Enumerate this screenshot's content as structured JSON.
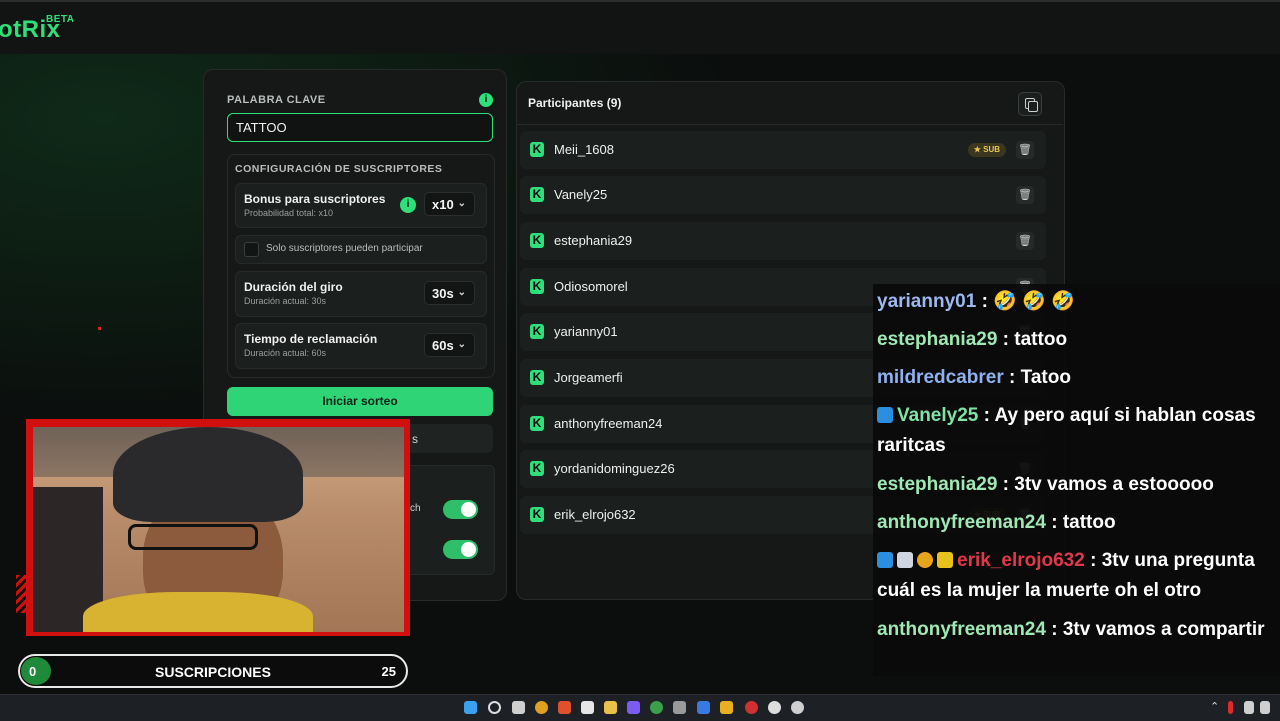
{
  "app": {
    "logo": "otRix",
    "badge": "BETA"
  },
  "keyword": {
    "label": "PALABRA CLAVE",
    "value": "TATTOO"
  },
  "subscriber_config": {
    "title": "CONFIGURACIÓN DE SUSCRIPTORES",
    "bonus": {
      "title": "Bonus para suscriptores",
      "subtitle": "Probabilidad total: x10",
      "value": "x10"
    },
    "subs_only": {
      "label": "Solo suscriptores pueden participar"
    },
    "spin_duration": {
      "title": "Duración del giro",
      "subtitle": "Duración actual: 30s",
      "value": "30s"
    },
    "claim_time": {
      "title": "Tiempo de reclamación",
      "subtitle": "Duración actual: 60s",
      "value": "60s"
    },
    "start_button": "Iniciar sorteo",
    "partial_button": "s",
    "partial_toggle_label": "ch"
  },
  "participants": {
    "title": "Participantes (9)",
    "sub_badge": "SUB",
    "list": [
      {
        "name": "Meii_1608",
        "sub": true
      },
      {
        "name": "Vanely25",
        "sub": false
      },
      {
        "name": "estephania29",
        "sub": false
      },
      {
        "name": "Odiosomorel",
        "sub": false
      },
      {
        "name": "yarianny01",
        "sub": false
      },
      {
        "name": "Jorgeamerfi",
        "sub": false
      },
      {
        "name": "anthonyfreeman24",
        "sub": false
      },
      {
        "name": "yordanidominguez26",
        "sub": false
      },
      {
        "name": "erik_elrojo632",
        "sub": true
      }
    ]
  },
  "chat": [
    {
      "user": "yarianny01",
      "text": " : 🤣 🤣 🤣"
    },
    {
      "user": "estephania29",
      "text": " : tattoo"
    },
    {
      "user": "mildredcabrer",
      "text": " : Tatoo"
    },
    {
      "user": "Vanely25",
      "text": " : Ay pero aquí si hablan cosas raritcas"
    },
    {
      "user": "estephania29",
      "text": " : 3tv vamos a estooooo"
    },
    {
      "user": "anthonyfreeman24",
      "text": " : tattoo"
    },
    {
      "user": "erik_elrojo632",
      "text": " : 3tv una pregunta cuál es la mujer la muerte oh el otro"
    },
    {
      "user": "anthonyfreeman24",
      "text": " : 3tv vamos a compartir"
    }
  ],
  "subs_goal": {
    "current": "0",
    "label": "SUSCRIPCIONES",
    "target": "25",
    "progress": 0
  },
  "colors": {
    "accent": "#2fe07a",
    "webcam_frame": "#d10f0f",
    "panel": "#151817"
  }
}
